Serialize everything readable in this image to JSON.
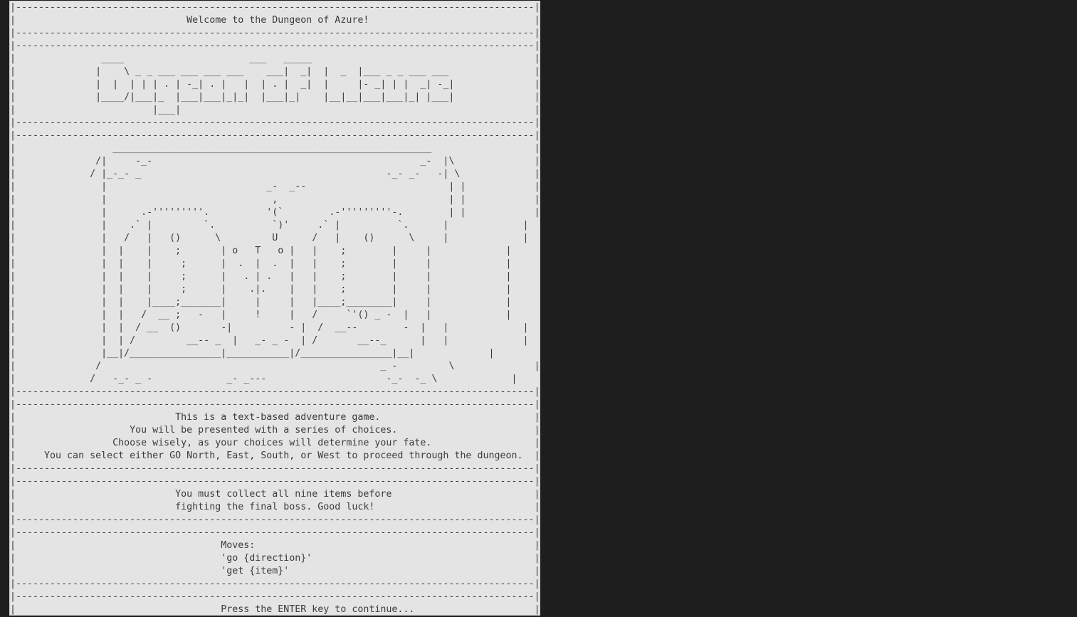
{
  "screen": {
    "lines": [
      "|-------------------------------------------------------------------------------------------|",
      "|                              Welcome to the Dungeon of Azure!                             |",
      "|-------------------------------------------------------------------------------------------|",
      "|-------------------------------------------------------------------------------------------|",
      "|               ____                      ___   _____                                       |",
      "|              |    \\ _ _ ___ ___ ___ ___    ___|  _|  |  _  |___ _ _ ___ ___               |",
      "|              |  |  | | | . | -_| . |   |  | . |  _|  |     |- _| | |  _| -_|              |",
      "|              |____/|___|_  |___|___|_|_|  |___|_|    |__|__|___|___|_| |___|              |",
      "|                        |___|                                                              |",
      "|-------------------------------------------------------------------------------------------|",
      "|-------------------------------------------------------------------------------------------|",
      "|                 ________________________________________________________                  |",
      "|              /|     -_-                                               _-  |\\              |",
      "|             / |_-_- _                                           -_- _-   -| \\             |",
      "|               |                            _-  _--                         | |            |",
      "|               |                             ,                              | |            |",
      "|               |      .-'''''''''.          '(`        .-'''''''''-.        | |            |",
      "|               |    .` |         `.          `)'     .` |          `.      |             |",
      "|               |   /   |   ()      \\         U      /   |    ()      \\     |             |",
      "|               |  |    |    ;       | o   T   o |   |    ;        |     |             |",
      "|               |  |    |     ;      |  .  |  .  |   |    ;        |     |             |",
      "|               |  |    |     ;      |   . | .   |   |    ;        |     |             |",
      "|               |  |    |     ;      |    .|.    |   |    ;        |     |             |",
      "|               |  |    |____;_______|     |     |   |____;________|     |             |",
      "|               |  |   /  __ ;   -   |     !     |   /     `'() _ -  |   |             |",
      "|               |  |  / __  ()       -|          - |  /  __--        -  |   |             |",
      "|               |  | /         __-- _  |   _- _ -  | /       __--_      |   |             |",
      "|               |__|/________________|___________|/________________|__|             |",
      "|              /                                                 _ -         \\              |",
      "|             /   -_- _ -             _- _---                     -_-  -_ \\             |",
      "|-------------------------------------------------------------------------------------------|",
      "|-------------------------------------------------------------------------------------------|",
      "|                            This is a text-based adventure game.                           |",
      "|                    You will be presented with a series of choices.                        |",
      "|                 Choose wisely, as your choices will determine your fate.                  |",
      "|     You can select either GO North, East, South, or West to proceed through the dungeon.  |",
      "|-------------------------------------------------------------------------------------------|",
      "|-------------------------------------------------------------------------------------------|",
      "|                            You must collect all nine items before                         |",
      "|                            fighting the final boss. Good luck!                            |",
      "|-------------------------------------------------------------------------------------------|",
      "|-------------------------------------------------------------------------------------------|",
      "|                                    Moves:                                                 |",
      "|                                    'go {direction}'                                       |",
      "|                                    'get {item}'                                           |",
      "|-------------------------------------------------------------------------------------------|",
      "|-------------------------------------------------------------------------------------------|",
      "|                                    Press the ENTER key to continue...                     |"
    ]
  }
}
